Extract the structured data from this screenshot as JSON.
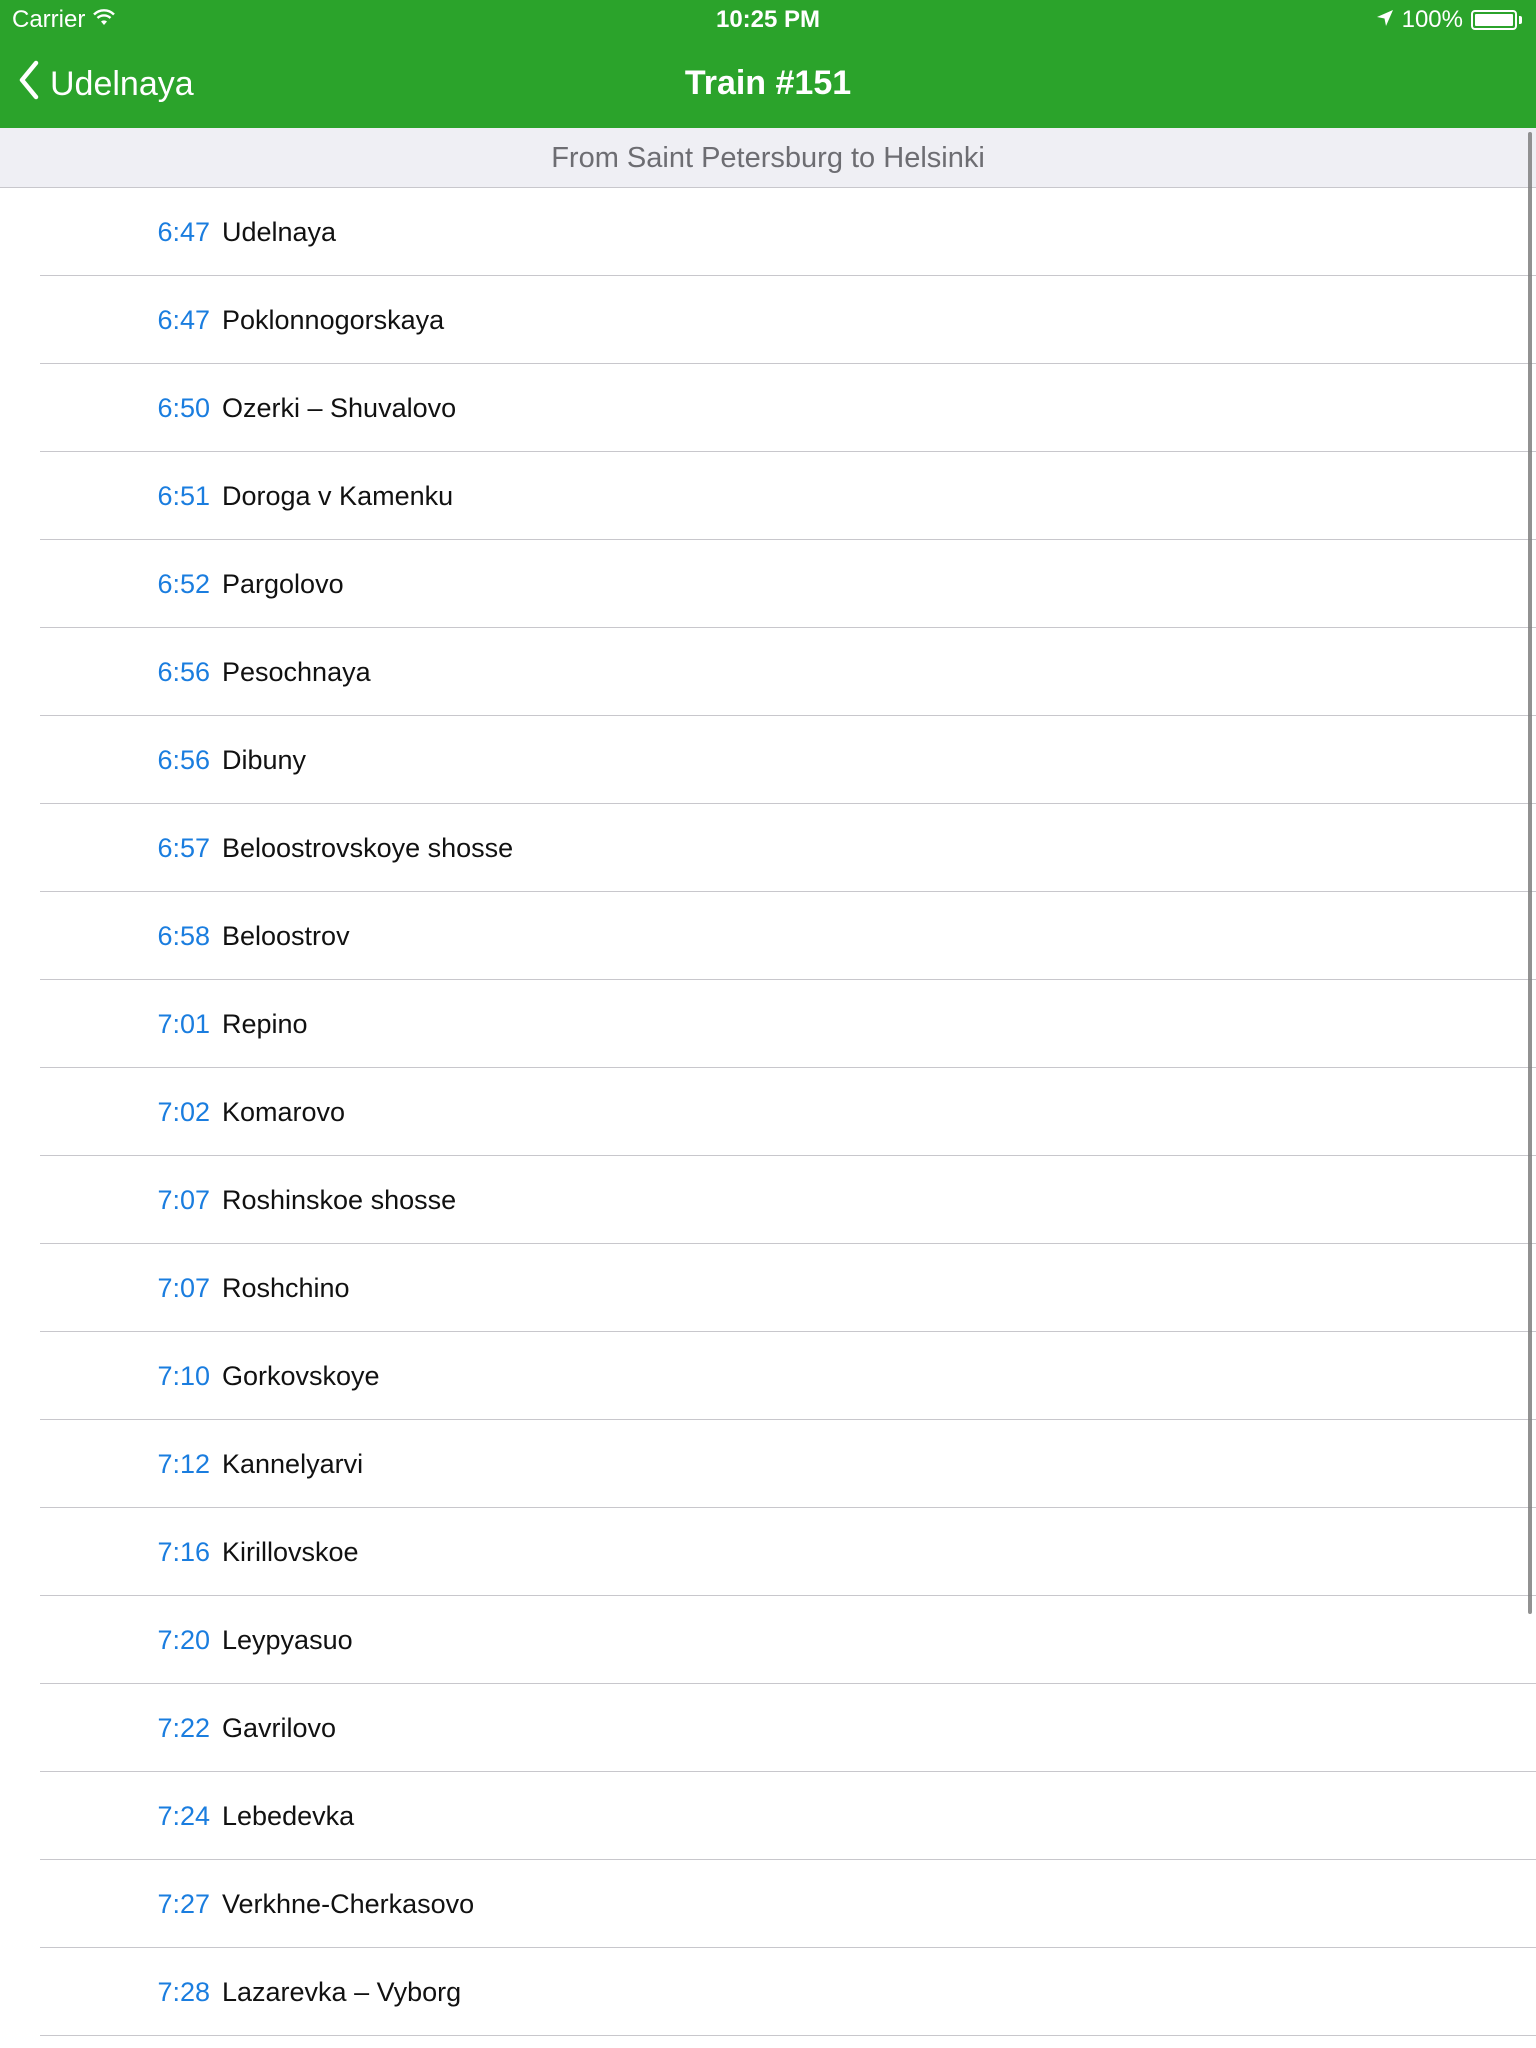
{
  "status_bar": {
    "carrier": "Carrier",
    "time": "10:25 PM",
    "battery": "100%",
    "icons": [
      "wifi-icon",
      "location-arrow-icon",
      "battery-icon"
    ]
  },
  "nav": {
    "back_label": "Udelnaya",
    "title": "Train #151",
    "back_icon": "chevron-left-icon"
  },
  "section": {
    "header": "From Saint Petersburg to Helsinki"
  },
  "stops": [
    {
      "time": "6:47",
      "station": "Udelnaya"
    },
    {
      "time": "6:47",
      "station": "Poklonnogorskaya"
    },
    {
      "time": "6:50",
      "station": "Ozerki – Shuvalovo"
    },
    {
      "time": "6:51",
      "station": "Doroga v Kamenku"
    },
    {
      "time": "6:52",
      "station": "Pargolovo"
    },
    {
      "time": "6:56",
      "station": "Pesochnaya"
    },
    {
      "time": "6:56",
      "station": "Dibuny"
    },
    {
      "time": "6:57",
      "station": "Beloostrovskoye shosse"
    },
    {
      "time": "6:58",
      "station": "Beloostrov"
    },
    {
      "time": "7:01",
      "station": "Repino"
    },
    {
      "time": "7:02",
      "station": "Komarovo"
    },
    {
      "time": "7:07",
      "station": "Roshinskoe shosse"
    },
    {
      "time": "7:07",
      "station": "Roshchino"
    },
    {
      "time": "7:10",
      "station": "Gorkovskoye"
    },
    {
      "time": "7:12",
      "station": "Kannelyarvi"
    },
    {
      "time": "7:16",
      "station": "Kirillovskoe"
    },
    {
      "time": "7:20",
      "station": "Leypyasuo"
    },
    {
      "time": "7:22",
      "station": "Gavrilovo"
    },
    {
      "time": "7:24",
      "station": "Lebedevka"
    },
    {
      "time": "7:27",
      "station": "Verkhne-Cherkasovo"
    },
    {
      "time": "7:28",
      "station": "Lazarevka – Vyborg"
    }
  ],
  "colors": {
    "nav_background": "#2ba32b",
    "time_text": "#1a7ddf",
    "section_background": "#efeff4"
  }
}
